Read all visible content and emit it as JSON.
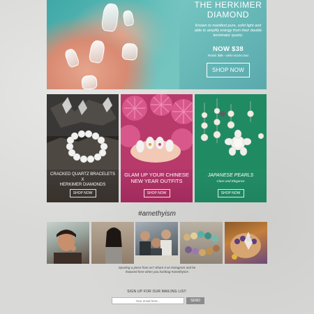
{
  "hero": {
    "title_line1": "THE HERKIMER",
    "title_line2": "DIAMOND",
    "description": "Known to manifest pure, solid light and able to amplify energy from their double terminator quartz.",
    "price": "NOW $38",
    "retail_note": "Retail: $88 - while stocks last",
    "cta_label": "SHOP NOW",
    "bg_color": "#74c4c0"
  },
  "cards": [
    {
      "title_line1": "CRACKED QUARTZ BRACELETS",
      "title_line2": "x",
      "title_line3": "HERKIMER DIAMONDS",
      "cta_label": "SHOP NOW",
      "bg_color": "#38312c"
    },
    {
      "title_line1": "GLAM UP YOUR CHINESE",
      "title_line2": "NEW YEAR OUTFITS",
      "cta_label": "SHOP NOW",
      "bg_color": "#a12a5c"
    },
    {
      "title": "JAPANESE PEARLS",
      "subtitle": "Class and Elegance",
      "cta_label": "SHOP NOW",
      "bg_color": "#1f8460"
    }
  ],
  "hashtag": "#amethyism",
  "instagram_caption_line1": "Sporting a piece from us? Share it on Instagram and be",
  "instagram_caption_line2": "featured here when you hashtag #amethyism",
  "newsletter": {
    "label": "SIGN UP FOR OUR MAILING LIST:",
    "placeholder": "Your email here...",
    "button_label": "SEND"
  }
}
